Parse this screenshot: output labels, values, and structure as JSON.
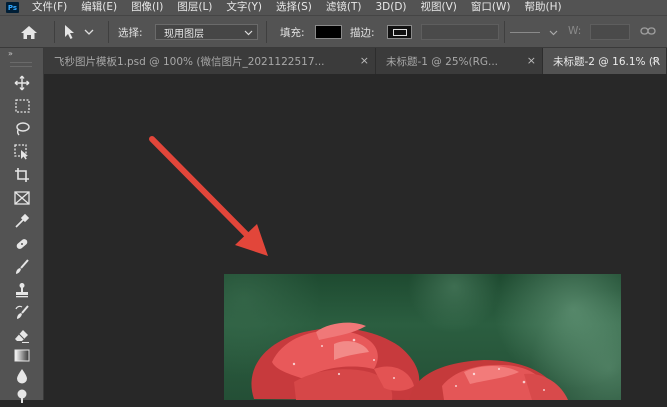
{
  "app": {
    "logo_text": "Ps"
  },
  "menu": [
    "文件(F)",
    "编辑(E)",
    "图像(I)",
    "图层(L)",
    "文字(Y)",
    "选择(S)",
    "滤镜(T)",
    "3D(D)",
    "视图(V)",
    "窗口(W)",
    "帮助(H)"
  ],
  "options": {
    "select_label": "选择:",
    "select_value": "现用图层",
    "fill_label": "填充:",
    "fill_color": "#000000",
    "stroke_label": "描边:",
    "width_label": "W:"
  },
  "tabs": [
    {
      "label": "飞秒图片模板1.psd @ 100% (微信图片_2021122517...",
      "close": "×",
      "active": false
    },
    {
      "label": "未标题-1 @ 25%(RG...",
      "close": "×",
      "active": false
    },
    {
      "label": "未标题-2 @ 16.1% (R",
      "close": "×",
      "active": true
    }
  ],
  "toolbar": {
    "collapse_glyph": "»"
  },
  "colors": {
    "accent_arrow": "#e2463a",
    "panel": "#535353",
    "canvas_bg": "#282828"
  },
  "icons": [
    "home-icon",
    "move-icon",
    "marquee-icon",
    "lasso-icon",
    "object-select-icon",
    "crop-icon",
    "frame-icon",
    "eyedropper-icon",
    "healing-brush-icon",
    "brush-icon",
    "clone-stamp-icon",
    "history-brush-icon",
    "eraser-icon",
    "gradient-icon",
    "blur-icon",
    "dodge-icon",
    "link-icon"
  ]
}
